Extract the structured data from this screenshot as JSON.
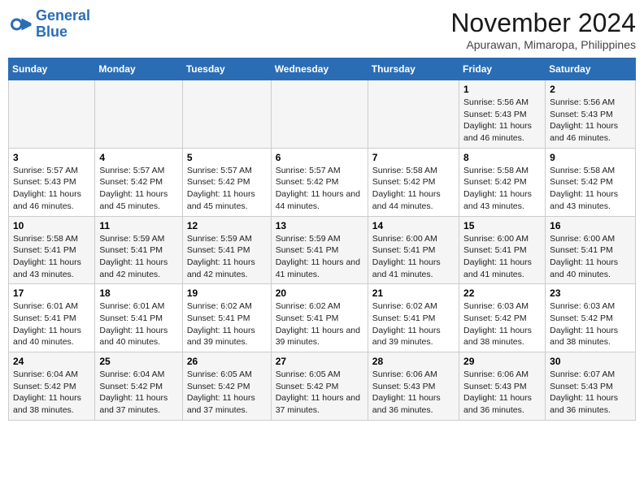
{
  "logo": {
    "line1": "General",
    "line2": "Blue"
  },
  "title": "November 2024",
  "subtitle": "Apurawan, Mimaropa, Philippines",
  "days_of_week": [
    "Sunday",
    "Monday",
    "Tuesday",
    "Wednesday",
    "Thursday",
    "Friday",
    "Saturday"
  ],
  "weeks": [
    [
      {
        "day": "",
        "info": ""
      },
      {
        "day": "",
        "info": ""
      },
      {
        "day": "",
        "info": ""
      },
      {
        "day": "",
        "info": ""
      },
      {
        "day": "",
        "info": ""
      },
      {
        "day": "1",
        "info": "Sunrise: 5:56 AM\nSunset: 5:43 PM\nDaylight: 11 hours and 46 minutes."
      },
      {
        "day": "2",
        "info": "Sunrise: 5:56 AM\nSunset: 5:43 PM\nDaylight: 11 hours and 46 minutes."
      }
    ],
    [
      {
        "day": "3",
        "info": "Sunrise: 5:57 AM\nSunset: 5:43 PM\nDaylight: 11 hours and 46 minutes."
      },
      {
        "day": "4",
        "info": "Sunrise: 5:57 AM\nSunset: 5:42 PM\nDaylight: 11 hours and 45 minutes."
      },
      {
        "day": "5",
        "info": "Sunrise: 5:57 AM\nSunset: 5:42 PM\nDaylight: 11 hours and 45 minutes."
      },
      {
        "day": "6",
        "info": "Sunrise: 5:57 AM\nSunset: 5:42 PM\nDaylight: 11 hours and 44 minutes."
      },
      {
        "day": "7",
        "info": "Sunrise: 5:58 AM\nSunset: 5:42 PM\nDaylight: 11 hours and 44 minutes."
      },
      {
        "day": "8",
        "info": "Sunrise: 5:58 AM\nSunset: 5:42 PM\nDaylight: 11 hours and 43 minutes."
      },
      {
        "day": "9",
        "info": "Sunrise: 5:58 AM\nSunset: 5:42 PM\nDaylight: 11 hours and 43 minutes."
      }
    ],
    [
      {
        "day": "10",
        "info": "Sunrise: 5:58 AM\nSunset: 5:41 PM\nDaylight: 11 hours and 43 minutes."
      },
      {
        "day": "11",
        "info": "Sunrise: 5:59 AM\nSunset: 5:41 PM\nDaylight: 11 hours and 42 minutes."
      },
      {
        "day": "12",
        "info": "Sunrise: 5:59 AM\nSunset: 5:41 PM\nDaylight: 11 hours and 42 minutes."
      },
      {
        "day": "13",
        "info": "Sunrise: 5:59 AM\nSunset: 5:41 PM\nDaylight: 11 hours and 41 minutes."
      },
      {
        "day": "14",
        "info": "Sunrise: 6:00 AM\nSunset: 5:41 PM\nDaylight: 11 hours and 41 minutes."
      },
      {
        "day": "15",
        "info": "Sunrise: 6:00 AM\nSunset: 5:41 PM\nDaylight: 11 hours and 41 minutes."
      },
      {
        "day": "16",
        "info": "Sunrise: 6:00 AM\nSunset: 5:41 PM\nDaylight: 11 hours and 40 minutes."
      }
    ],
    [
      {
        "day": "17",
        "info": "Sunrise: 6:01 AM\nSunset: 5:41 PM\nDaylight: 11 hours and 40 minutes."
      },
      {
        "day": "18",
        "info": "Sunrise: 6:01 AM\nSunset: 5:41 PM\nDaylight: 11 hours and 40 minutes."
      },
      {
        "day": "19",
        "info": "Sunrise: 6:02 AM\nSunset: 5:41 PM\nDaylight: 11 hours and 39 minutes."
      },
      {
        "day": "20",
        "info": "Sunrise: 6:02 AM\nSunset: 5:41 PM\nDaylight: 11 hours and 39 minutes."
      },
      {
        "day": "21",
        "info": "Sunrise: 6:02 AM\nSunset: 5:41 PM\nDaylight: 11 hours and 39 minutes."
      },
      {
        "day": "22",
        "info": "Sunrise: 6:03 AM\nSunset: 5:42 PM\nDaylight: 11 hours and 38 minutes."
      },
      {
        "day": "23",
        "info": "Sunrise: 6:03 AM\nSunset: 5:42 PM\nDaylight: 11 hours and 38 minutes."
      }
    ],
    [
      {
        "day": "24",
        "info": "Sunrise: 6:04 AM\nSunset: 5:42 PM\nDaylight: 11 hours and 38 minutes."
      },
      {
        "day": "25",
        "info": "Sunrise: 6:04 AM\nSunset: 5:42 PM\nDaylight: 11 hours and 37 minutes."
      },
      {
        "day": "26",
        "info": "Sunrise: 6:05 AM\nSunset: 5:42 PM\nDaylight: 11 hours and 37 minutes."
      },
      {
        "day": "27",
        "info": "Sunrise: 6:05 AM\nSunset: 5:42 PM\nDaylight: 11 hours and 37 minutes."
      },
      {
        "day": "28",
        "info": "Sunrise: 6:06 AM\nSunset: 5:43 PM\nDaylight: 11 hours and 36 minutes."
      },
      {
        "day": "29",
        "info": "Sunrise: 6:06 AM\nSunset: 5:43 PM\nDaylight: 11 hours and 36 minutes."
      },
      {
        "day": "30",
        "info": "Sunrise: 6:07 AM\nSunset: 5:43 PM\nDaylight: 11 hours and 36 minutes."
      }
    ]
  ]
}
